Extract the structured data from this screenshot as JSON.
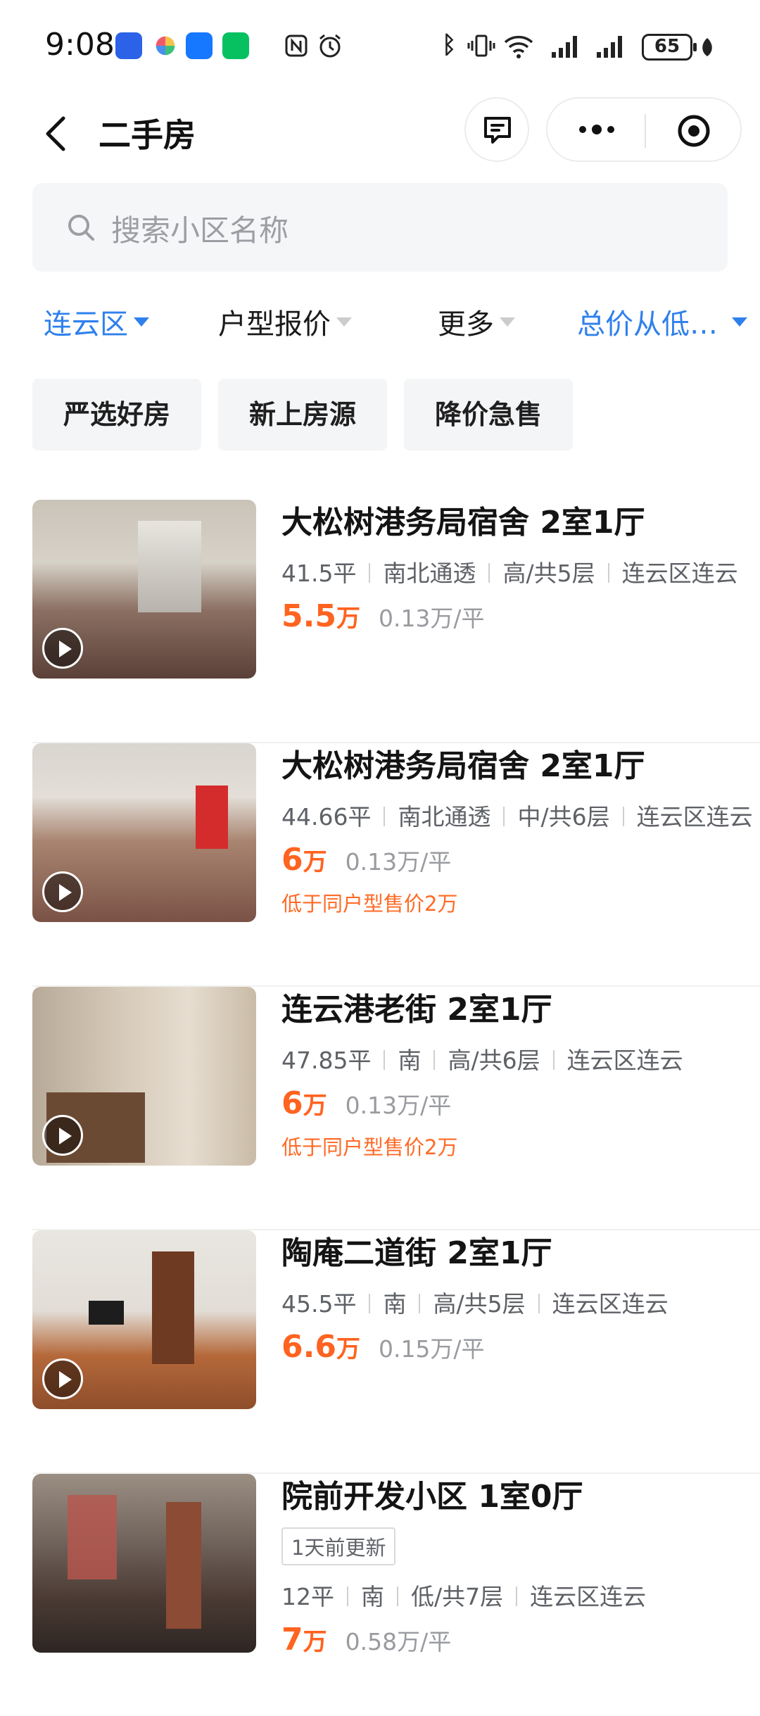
{
  "status_bar": {
    "time": "9:08",
    "battery": "65"
  },
  "nav": {
    "title": "二手房"
  },
  "search": {
    "placeholder": "搜索小区名称"
  },
  "filters": [
    {
      "label": "连云区",
      "active": true
    },
    {
      "label": "户型报价",
      "active": false
    },
    {
      "label": "更多",
      "active": false
    },
    {
      "label": "总价从低…",
      "active": true
    }
  ],
  "tags": [
    "严选好房",
    "新上房源",
    "降价急售"
  ],
  "listings": [
    {
      "title": "大松树港务局宿舍 2室1厅",
      "area": "41.5平",
      "orientation": "南北通透",
      "floor": "高/共5层",
      "district": "连云区连云",
      "price": "5.5",
      "price_unit": "万",
      "unit_price": "0.13万/平",
      "promo": "",
      "badge": ""
    },
    {
      "title": "大松树港务局宿舍 2室1厅",
      "area": "44.66平",
      "orientation": "南北通透",
      "floor": "中/共6层",
      "district": "连云区连云",
      "price": "6",
      "price_unit": "万",
      "unit_price": "0.13万/平",
      "promo": "低于同户型售价2万",
      "badge": ""
    },
    {
      "title": "连云港老街 2室1厅",
      "area": "47.85平",
      "orientation": "南",
      "floor": "高/共6层",
      "district": "连云区连云",
      "price": "6",
      "price_unit": "万",
      "unit_price": "0.13万/平",
      "promo": "低于同户型售价2万",
      "badge": ""
    },
    {
      "title": "陶庵二道街 2室1厅",
      "area": "45.5平",
      "orientation": "南",
      "floor": "高/共5层",
      "district": "连云区连云",
      "price": "6.6",
      "price_unit": "万",
      "unit_price": "0.15万/平",
      "promo": "",
      "badge": ""
    },
    {
      "title": "院前开发小区 1室0厅",
      "area": "12平",
      "orientation": "南",
      "floor": "低/共7层",
      "district": "连云区连云",
      "price": "7",
      "price_unit": "万",
      "unit_price": "0.58万/平",
      "promo": "",
      "badge": "1天前更新"
    }
  ],
  "colors": {
    "accent_blue": "#2f80ed",
    "price_orange": "#ff6320"
  }
}
